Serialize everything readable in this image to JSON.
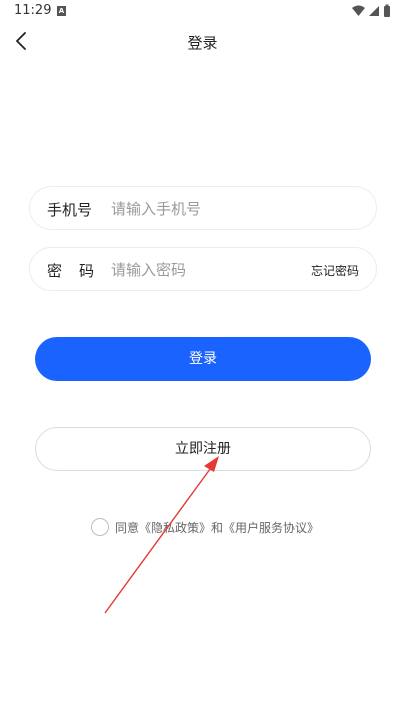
{
  "status_bar": {
    "time": "11:29",
    "notification_glyph": "A",
    "icons": [
      "wifi-icon",
      "signal-icon",
      "battery-icon"
    ]
  },
  "nav": {
    "title": "登录",
    "back_icon": "chevron-left-icon"
  },
  "form": {
    "phone": {
      "label": "手机号",
      "placeholder": "请输入手机号",
      "value": ""
    },
    "password": {
      "label": "密码",
      "placeholder": "请输入密码",
      "value": "",
      "forgot_label": "忘记密码"
    }
  },
  "actions": {
    "login_label": "登录",
    "register_label": "立即注册"
  },
  "agreement": {
    "checked": false,
    "prefix": "同意",
    "privacy_link": "《隐私政策》",
    "joiner": "和",
    "terms_link": "《用户服务协议》"
  },
  "colors": {
    "primary": "#1a63ff",
    "annotation_arrow": "#e53935"
  }
}
